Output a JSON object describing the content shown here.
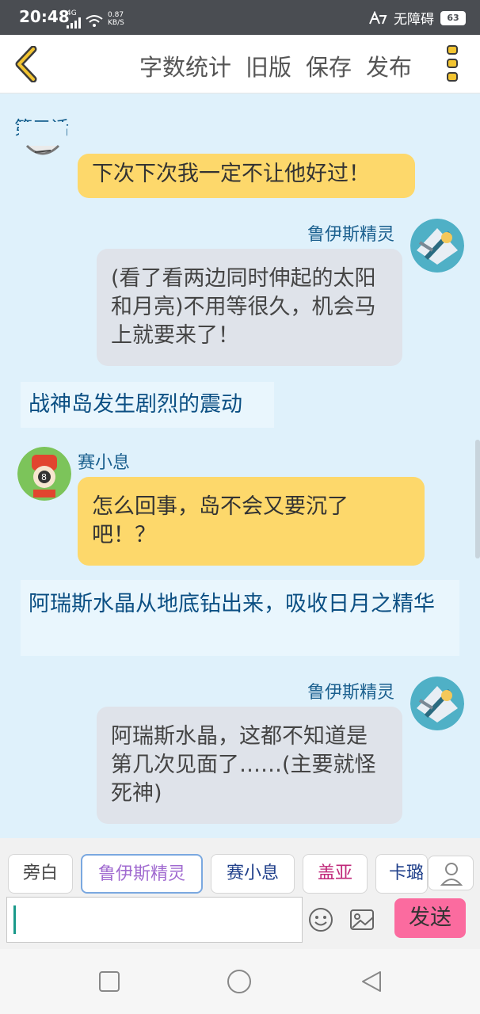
{
  "status_bar": {
    "time": "20:48",
    "network": "4G",
    "speed_value": "0.87",
    "speed_unit": "KB/S",
    "accessibility": "无障碍",
    "battery": "63"
  },
  "toolbar": {
    "actions": [
      "字数统计",
      "旧版",
      "保存",
      "发布"
    ]
  },
  "chat": {
    "chapter": "第三话",
    "messages": [
      {
        "type": "bubble",
        "side": "left",
        "text": "下次下次我一定不让他好过！"
      },
      {
        "type": "bubble",
        "side": "right",
        "speaker": "鲁伊斯精灵",
        "text": "(看了看两边同时伸起的太阳和月亮)不用等很久，机会马上就要来了！"
      },
      {
        "type": "narration",
        "text": "战神岛发生剧烈的震动"
      },
      {
        "type": "bubble",
        "side": "left",
        "speaker": "赛小息",
        "text": "怎么回事，岛不会又要沉了吧！？"
      },
      {
        "type": "narration",
        "text": "阿瑞斯水晶从地底钻出来，吸收日月之精华"
      },
      {
        "type": "bubble",
        "side": "right",
        "speaker": "鲁伊斯精灵",
        "text": "阿瑞斯水晶，这都不知道是第几次见面了……(主要就怪死神)"
      }
    ]
  },
  "composer": {
    "roles": [
      {
        "label": "旁白",
        "color": "#444444"
      },
      {
        "label": "鲁伊斯精灵",
        "color": "#a06ad0"
      },
      {
        "label": "赛小息",
        "color": "#1f3f8a"
      },
      {
        "label": "盖亚",
        "color": "#c0287a"
      },
      {
        "label": "卡璐",
        "color": "#1f3f8a"
      }
    ],
    "input_value": "",
    "send_label": "发送"
  },
  "colors": {
    "accent": "#fb6b9f",
    "yellow_bubble": "#fdd86b",
    "gray_bubble": "#dfe3ea",
    "chat_bg": "#dff1fb",
    "narration_text": "#0b4f83"
  }
}
